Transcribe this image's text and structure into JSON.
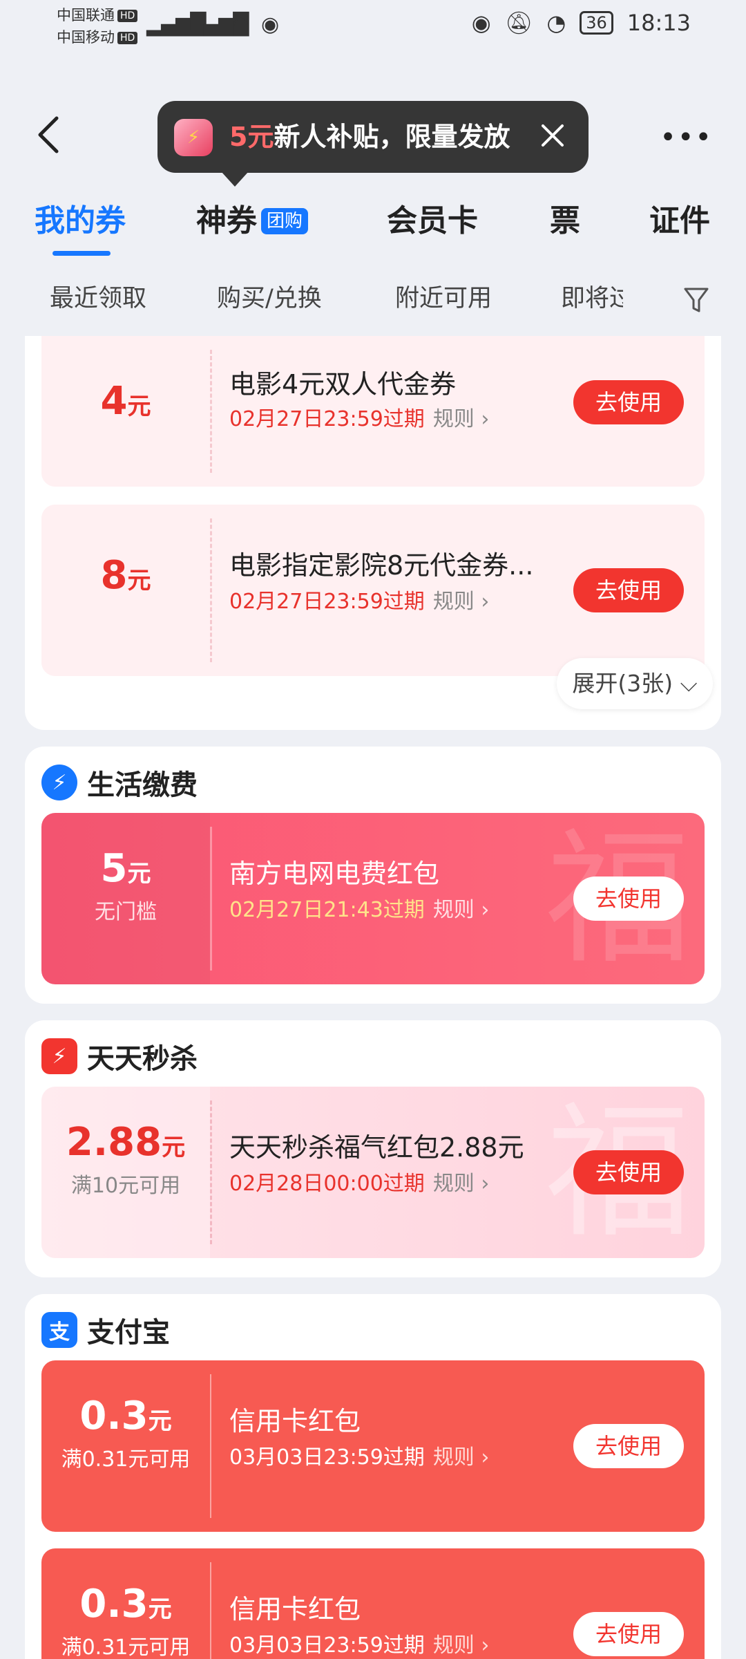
{
  "status_bar": {
    "carrier1": "中国联通",
    "carrier2": "中国移动",
    "hd": "HD",
    "battery": "36",
    "time": "18:13"
  },
  "bubble": {
    "highlight": "5元",
    "text": "新人补贴，限量发放"
  },
  "tabs": [
    {
      "label": "我的券"
    },
    {
      "label": "神券",
      "badge": "团购"
    },
    {
      "label": "会员卡"
    },
    {
      "label": "票"
    },
    {
      "label": "证件"
    }
  ],
  "subtabs": [
    "最近领取",
    "购买/兑换",
    "附近可用",
    "即将过"
  ],
  "unit": "元",
  "rule_label": "规则",
  "use_label": "去使用",
  "expand_label": "展开(3张)",
  "movie_coupons": [
    {
      "amount": "4",
      "title": "电影4元双人代金券",
      "expiry": "02月27日23:59过期"
    },
    {
      "amount": "8",
      "title": "电影指定影院8元代金券...",
      "expiry": "02月27日23:59过期"
    }
  ],
  "sections": [
    {
      "title": "生活缴费",
      "coupons": [
        {
          "amount": "5",
          "condition": "无门槛",
          "title": "南方电网电费红包",
          "expiry": "02月27日21:43过期"
        }
      ]
    },
    {
      "title": "天天秒杀",
      "coupons": [
        {
          "amount": "2.88",
          "condition": "满10元可用",
          "title": "天天秒杀福气红包2.88元",
          "expiry": "02月28日00:00过期"
        }
      ]
    },
    {
      "title": "支付宝",
      "coupons": [
        {
          "amount": "0.3",
          "condition": "满0.31元可用",
          "title": "信用卡红包",
          "expiry": "03月03日23:59过期"
        },
        {
          "amount": "0.3",
          "condition": "满0.31元可用",
          "title": "信用卡红包",
          "expiry": "03月03日23:59过期"
        }
      ]
    }
  ],
  "colors": {
    "accent": "#1677ff",
    "coupon_red": "#f2352f",
    "background": "#eef0f5"
  }
}
